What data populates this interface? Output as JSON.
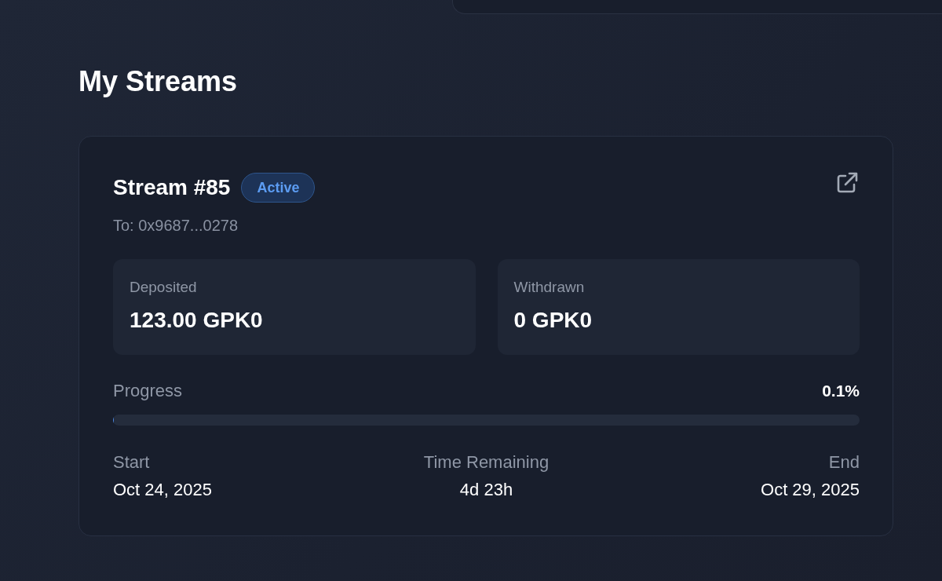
{
  "page": {
    "title": "My Streams"
  },
  "streams": [
    {
      "title": "Stream #85",
      "status": {
        "label": "Active",
        "kind": "active"
      },
      "recipient": "To: 0x9687...0278",
      "stats": [
        {
          "label": "Deposited",
          "value": "123.00 GPK0"
        },
        {
          "label": "Withdrawn",
          "value": "0 GPK0"
        }
      ],
      "progress": {
        "label": "Progress",
        "reading": "0.1%",
        "level": 0.001
      },
      "timeline": [
        {
          "label": "Start",
          "value": "Oct 24, 2025"
        },
        {
          "label": "Time Remaining",
          "value": "4d 23h"
        },
        {
          "label": "End",
          "value": "Oct 29, 2025"
        }
      ]
    }
  ]
}
